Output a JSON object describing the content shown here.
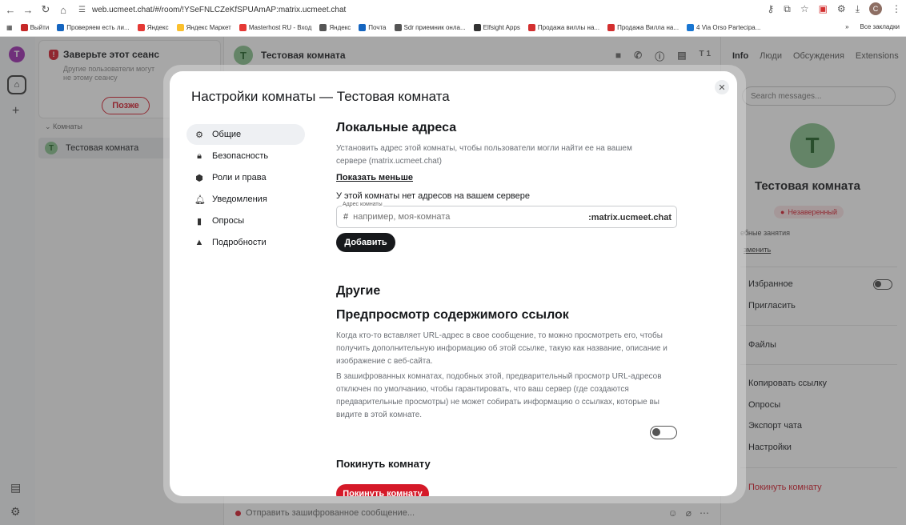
{
  "browser": {
    "url": "web.ucmeet.chat/#/room/!YSeFNLCZeKfSPUAmAP:matrix.ucmeet.chat",
    "bookmarks": [
      "Выйти",
      "Проверяем есть ли...",
      "Яндекс",
      "Яндекс Маркет",
      "Masterhost RU - Вход",
      "Яндекс",
      "Почта",
      "Sdr приемник онла...",
      "Elfsight Apps",
      "Продажа виллы на...",
      "Продажа Вилла на...",
      "4 Via Orso Partecipa..."
    ],
    "all_bookmarks": "Все закладки",
    "profile_initial": "C"
  },
  "spaces": {
    "avatar": "T"
  },
  "roomlist": {
    "verify_title": "Заверьте этот сеанс",
    "verify_desc": "Другие пользователи могут не этому сеансу",
    "later": "Позже",
    "section": "Комнаты",
    "room_name": "Тестовая комната",
    "room_initial": "T"
  },
  "room": {
    "name": "Тестовая комната",
    "initial": "T",
    "member_initial": "T",
    "member_count": "1",
    "composer_placeholder": "Отправить зашифрованное сообщение..."
  },
  "right_panel": {
    "tabs": [
      "Info",
      "Люди",
      "Обсуждения",
      "Extensions"
    ],
    "search": "Search messages...",
    "avatar": "T",
    "name": "Тестовая комната",
    "badge": "Незаверенный",
    "topic": "ебные занятия",
    "change": "зменить",
    "items": [
      "Избранное",
      "Пригласить",
      "Файлы",
      "Копировать ссылку",
      "Опросы",
      "Экспорт чата",
      "Настройки"
    ],
    "leave": "Покинуть комнату"
  },
  "dialog": {
    "title": "Настройки комнаты — Тестовая комната",
    "menu": [
      "Общие",
      "Безопасность",
      "Роли и права",
      "Уведомления",
      "Опросы",
      "Подробности"
    ],
    "local_addresses_title": "Локальные адреса",
    "local_addresses_desc": "Установить адрес этой комнаты, чтобы пользователи могли найти ее на вашем сервере (matrix.ucmeet.chat)",
    "show_less": "Показать меньше",
    "no_addresses": "У этой комнаты нет адресов на вашем сервере",
    "field_label": "Адрес комнаты",
    "field_placeholder": "например, моя-комната",
    "field_suffix": ":matrix.ucmeet.chat",
    "add_button": "Добавить",
    "other_title": "Другие",
    "preview_title": "Предпросмотр содержимого ссылок",
    "preview_desc1": "Когда кто-то вставляет URL-адрес в свое сообщение, то можно просмотреть его, чтобы получить дополнительную информацию об этой ссылке, такую как название, описание и изображение с веб-сайта.",
    "preview_desc2": "В зашифрованных комнатах, подобных этой, предварительный просмотр URL-адресов отключен по умолчанию, чтобы гарантировать, что ваш сервер (где создаются предварительные просмотры) не может собирать информацию о ссылках, которые вы видите в этой комнате.",
    "leave_title": "Покинуть комнату",
    "leave_button": "Покинуть комнату"
  }
}
